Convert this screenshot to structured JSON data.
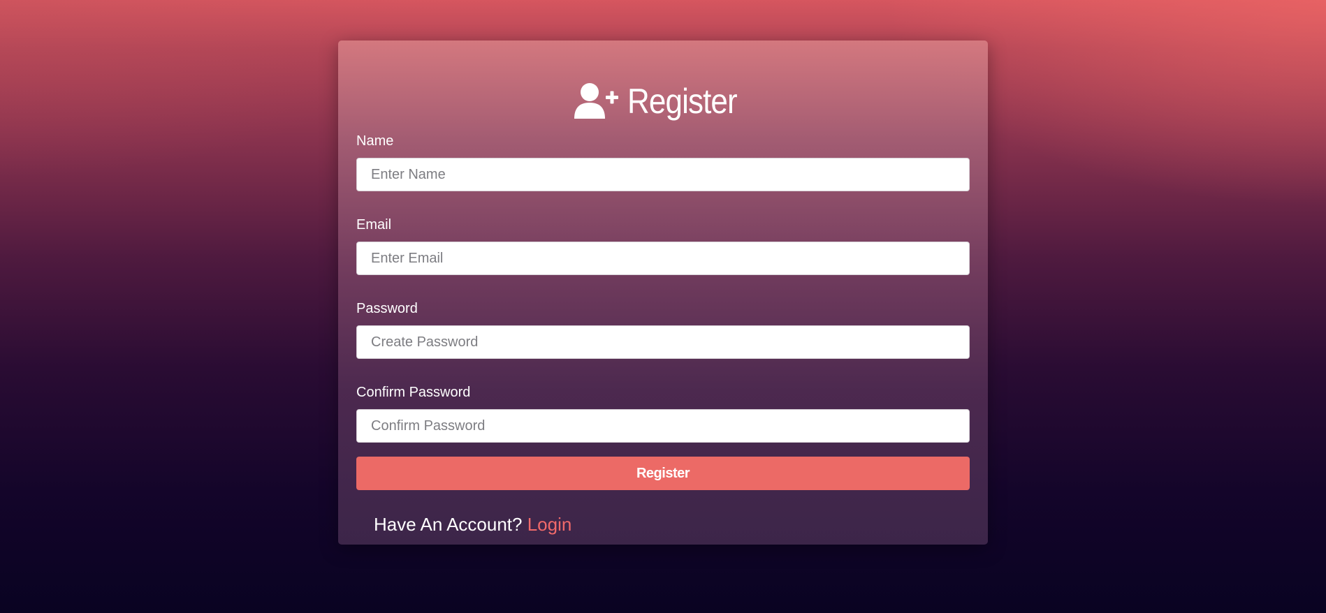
{
  "colors": {
    "accent": "#ec6a66",
    "link": "#f06a6a",
    "text": "#ffffff"
  },
  "form": {
    "title": "Register",
    "title_icon": "user-plus-icon",
    "fields": [
      {
        "label": "Name",
        "placeholder": "Enter Name",
        "value": ""
      },
      {
        "label": "Email",
        "placeholder": "Enter Email",
        "value": ""
      },
      {
        "label": "Password",
        "placeholder": "Create Password",
        "value": ""
      },
      {
        "label": "Confirm Password",
        "placeholder": "Confirm Password",
        "value": ""
      }
    ],
    "submit_label": "Register"
  },
  "footer": {
    "prompt": "Have An Account?",
    "link_label": "Login"
  }
}
